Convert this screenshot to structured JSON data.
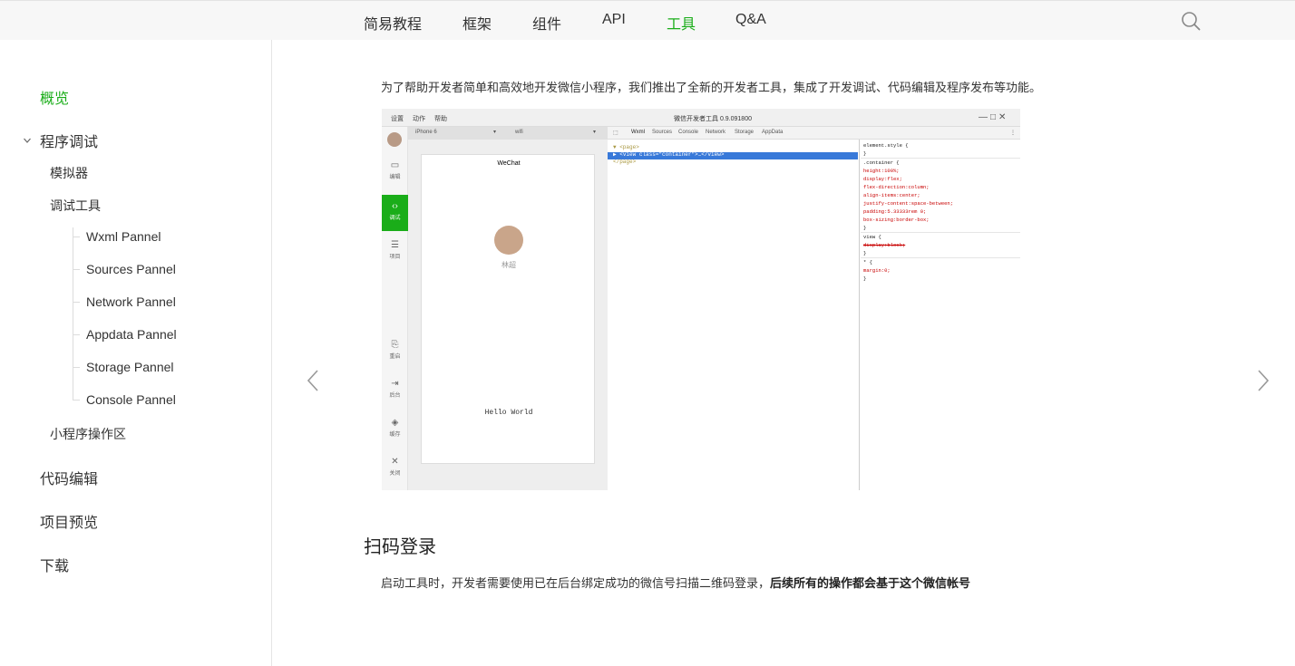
{
  "nav": {
    "items": [
      {
        "label": "简易教程",
        "active": false
      },
      {
        "label": "框架",
        "active": false
      },
      {
        "label": "组件",
        "active": false
      },
      {
        "label": "API",
        "active": false
      },
      {
        "label": "工具",
        "active": true
      },
      {
        "label": "Q&A",
        "active": false
      }
    ],
    "search_icon": "search-icon",
    "accent_color": "#1aad19"
  },
  "sidebar": {
    "overview": "概览",
    "debug": {
      "label": "程序调试",
      "expanded": true,
      "simulator": "模拟器",
      "tools": "调试工具",
      "panels": [
        "Wxml Pannel",
        "Sources Pannel",
        "Network Pannel",
        "Appdata Pannel",
        "Storage Pannel",
        "Console Pannel"
      ],
      "operation_area": "小程序操作区"
    },
    "code_edit": "代码编辑",
    "preview": "项目预览",
    "download": "下载"
  },
  "main": {
    "intro": "为了帮助开发者简单和高效地开发微信小程序，我们推出了全新的开发者工具，集成了开发调试、代码编辑及程序发布等功能。",
    "section_title": "扫码登录",
    "para_normal": "启动工具时，开发者需要使用已在后台绑定成功的微信号扫描二维码登录，",
    "para_bold": "后续所有的操作都会基于这个微信帐号"
  },
  "screenshot": {
    "menu": [
      "设置",
      "动作",
      "帮助"
    ],
    "window_title": "微信开发者工具 0.9.091800",
    "left_tools": [
      "编辑",
      "调试",
      "项目",
      "重启",
      "后台",
      "缓存",
      "关闭"
    ],
    "device": "iPhone 6",
    "network": "wifi",
    "phone_title": "WeChat",
    "user_name": "林超",
    "hello": "Hello World",
    "dev_tabs": [
      "Wxml",
      "Sources",
      "Console",
      "Network",
      "Storage",
      "AppData"
    ],
    "wxml_lines": [
      "▼ <page>",
      "  ▶ <view class=\"container\">…</view>",
      "</page>"
    ],
    "style_lines": [
      "element.style {",
      "}",
      ".container {",
      "  height:100%;",
      "  display:flex;",
      "  flex-direction:column;",
      "  align-items:center;",
      "  justify-content:space-between;",
      "  padding:5.33333rem 0;",
      "  box-sizing:border-box;",
      "}",
      "view {",
      "  display:block;",
      "}",
      "* {",
      "  margin:0;",
      "}"
    ]
  }
}
